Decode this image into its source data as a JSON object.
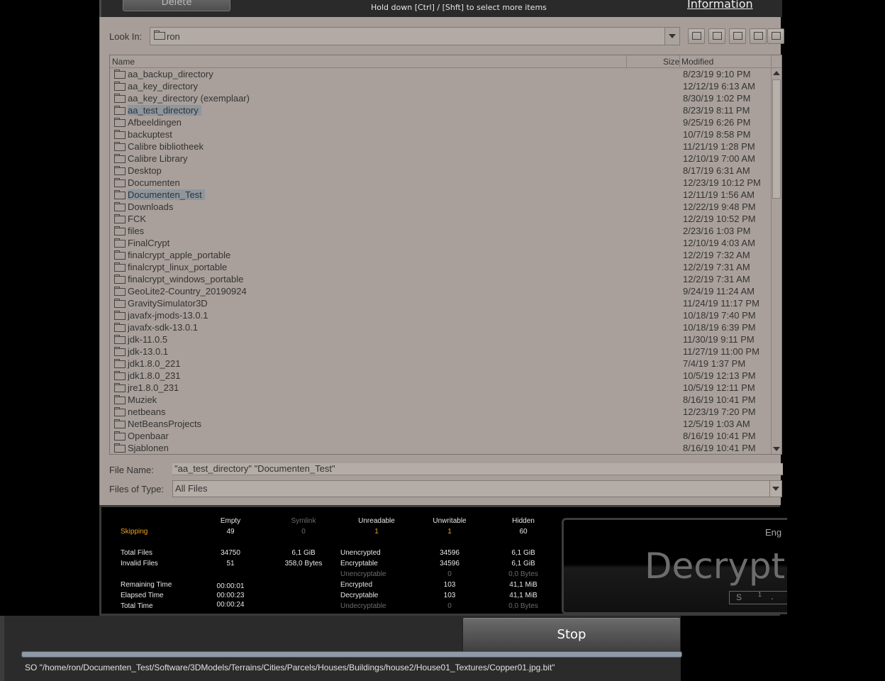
{
  "top": {
    "delete_label": "Delete",
    "hint": "Hold down [Ctrl] / [Shft] to select more items",
    "information_label": "Information"
  },
  "chooser": {
    "look_in_label": "Look In:",
    "look_in_value": "ron",
    "columns": {
      "name": "Name",
      "size": "Size",
      "modified": "Modified"
    },
    "rows": [
      {
        "name": "aa_backup_directory",
        "modified": "8/23/19 9:10 PM"
      },
      {
        "name": "aa_key_directory",
        "modified": "12/12/19 6:13 AM"
      },
      {
        "name": "aa_key_directory (exemplaar)",
        "modified": "8/30/19 1:02 PM"
      },
      {
        "name": "aa_test_directory",
        "modified": "8/23/19 8:11 PM"
      },
      {
        "name": "Afbeeldingen",
        "modified": "9/25/19 6:26 PM"
      },
      {
        "name": "backuptest",
        "modified": "10/7/19 8:58 PM"
      },
      {
        "name": "Calibre bibliotheek",
        "modified": "11/21/19 1:28 PM"
      },
      {
        "name": "Calibre Library",
        "modified": "12/10/19 7:00 AM"
      },
      {
        "name": "Desktop",
        "modified": "8/17/19 6:31 AM"
      },
      {
        "name": "Documenten",
        "modified": "12/23/19 10:12 PM"
      },
      {
        "name": "Documenten_Test",
        "modified": "12/11/19 1:56 AM"
      },
      {
        "name": "Downloads",
        "modified": "12/22/19 9:48 PM"
      },
      {
        "name": "FCK",
        "modified": "12/2/19 10:52 PM"
      },
      {
        "name": "files",
        "modified": "2/23/16 1:03 PM"
      },
      {
        "name": "FinalCrypt",
        "modified": "12/10/19 4:03 AM"
      },
      {
        "name": "finalcrypt_apple_portable",
        "modified": "12/2/19 7:32 AM"
      },
      {
        "name": "finalcrypt_linux_portable",
        "modified": "12/2/19 7:31 AM"
      },
      {
        "name": "finalcrypt_windows_portable",
        "modified": "12/2/19 7:31 AM"
      },
      {
        "name": "GeoLite2-Country_20190924",
        "modified": "9/24/19 11:24 AM"
      },
      {
        "name": "GravitySimulator3D",
        "modified": "11/24/19 11:17 PM"
      },
      {
        "name": "javafx-jmods-13.0.1",
        "modified": "10/18/19 7:40 PM"
      },
      {
        "name": "javafx-sdk-13.0.1",
        "modified": "10/18/19 6:39 PM"
      },
      {
        "name": "jdk-11.0.5",
        "modified": "11/30/19 9:11 PM"
      },
      {
        "name": "jdk-13.0.1",
        "modified": "11/27/19 11:00 PM"
      },
      {
        "name": "jdk1.8.0_221",
        "modified": "7/4/19 1:37 PM"
      },
      {
        "name": "jdk1.8.0_231",
        "modified": "10/5/19 12:13 PM"
      },
      {
        "name": "jre1.8.0_231",
        "modified": "10/5/19 12:11 PM"
      },
      {
        "name": "Muziek",
        "modified": "8/16/19 10:41 PM"
      },
      {
        "name": "netbeans",
        "modified": "12/23/19 7:20 PM"
      },
      {
        "name": "NetBeansProjects",
        "modified": "12/5/19 1:03 AM"
      },
      {
        "name": "Openbaar",
        "modified": "8/16/19 10:41 PM"
      },
      {
        "name": "Sjablonen",
        "modified": "8/16/19 10:41 PM"
      }
    ],
    "selected": [
      "aa_test_directory",
      "Documenten_Test"
    ],
    "file_name_label": "File Name:",
    "file_name_value": "\"aa_test_directory\" \"Documenten_Test\"",
    "files_of_type_label": "Files of Type:",
    "files_of_type_value": "All Files"
  },
  "stats": {
    "headers": {
      "empty": "Empty",
      "symlink": "Symlink",
      "unreadable": "Unreadable",
      "unwritable": "Unwritable",
      "hidden": "Hidden"
    },
    "skipping_label": "Skipping",
    "skipping": {
      "empty": "49",
      "symlink": "0",
      "unreadable": "1",
      "unwritable": "1",
      "hidden": "60"
    },
    "total_files_label": "Total Files",
    "total_files_count": "34750",
    "total_files_size": "6,1 GiB",
    "invalid_files_label": "Invalid Files",
    "invalid_files_count": "51",
    "invalid_files_size": "358,0 Bytes",
    "remaining_time_label": "Remaining Time",
    "remaining_time": "00:00:01",
    "elapsed_time_label": "Elapsed Time",
    "elapsed_time": "00:00:23",
    "total_time_label": "Total Time",
    "total_time": "00:00:24",
    "unencrypted_label": "Unencrypted",
    "unencrypted_count": "34596",
    "unencrypted_size": "6,1 GiB",
    "encryptable_label": "Encryptable",
    "encryptable_count": "34596",
    "encryptable_size": "6,1 GiB",
    "unencryptable_label": "Unencryptable",
    "unencryptable_count": "0",
    "unencryptable_size": "0,0 Bytes",
    "encrypted_label": "Encrypted",
    "encrypted_count": "103",
    "encrypted_size": "41,1 MiB",
    "decryptable_label": "Decryptable",
    "decryptable_count": "103",
    "decryptable_size": "41,1 MiB",
    "undecryptable_label": "Undecryptable",
    "undecryptable_count": "0",
    "undecryptable_size": "0,0 Bytes"
  },
  "status_box": {
    "eng": "Eng",
    "big": "Decrypti",
    "mini_s": "S",
    "mini_1": "1",
    "mini_dot": "."
  },
  "bottom": {
    "stop_label": "Stop",
    "path": "SO \"/home/ron/Documenten_Test/Software/3DModels/Terrains/Cities/Parcels/Houses/Buildings/house2/House01_Textures/Copper01.jpg.bit\""
  },
  "colors": {
    "accent_orange": "#f0a020",
    "chooser_bg": "#a79e99",
    "selection": "#8e969e"
  }
}
